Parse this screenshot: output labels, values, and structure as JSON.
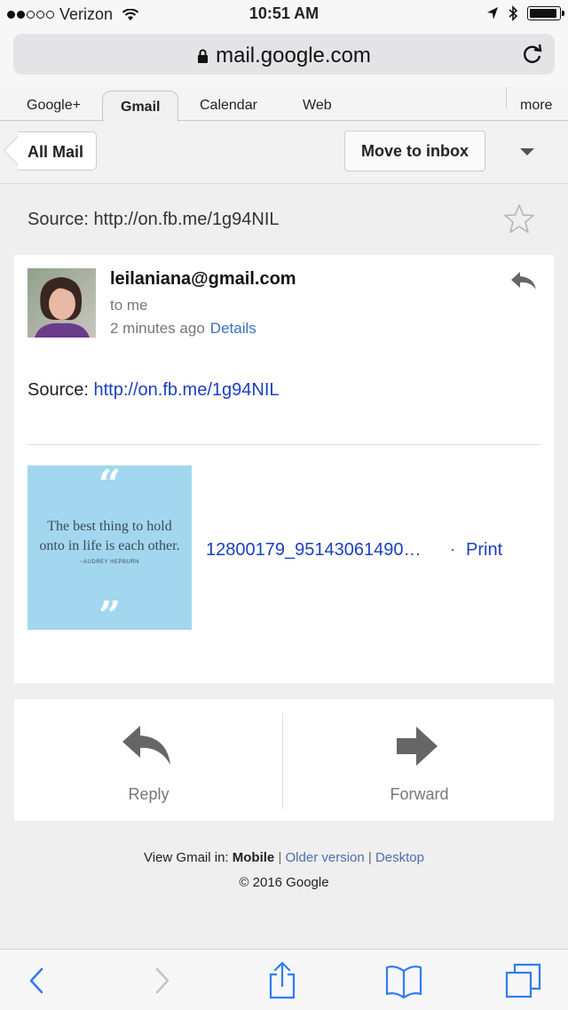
{
  "status_bar": {
    "carrier": "Verizon",
    "time": "10:51 AM",
    "signal_bars_filled": 2,
    "signal_bars_total": 5,
    "battery_level": 0.95
  },
  "browser": {
    "url": "mail.google.com"
  },
  "google_tabs": [
    "Google+",
    "Gmail",
    "Calendar",
    "Web",
    "more"
  ],
  "toolbar": {
    "back_label": "All Mail",
    "move_label": "Move to inbox"
  },
  "message": {
    "subject": "Source: http://on.fb.me/1g94NIL",
    "sender": "leilaniana@gmail.com",
    "recipient": "to me",
    "time": "2 minutes ago",
    "details_label": "Details",
    "body_prefix": "Source: ",
    "body_link": "http://on.fb.me/1g94NIL",
    "attachment": {
      "name": "12800179_95143061490…",
      "separator": "·",
      "print_label": "Print",
      "quote_line1": "The best thing to hold",
      "quote_line2": "onto in life is each other.",
      "quote_author": "~AUDREY HEPBURN"
    }
  },
  "actions": {
    "reply_label": "Reply",
    "forward_label": "Forward"
  },
  "footer": {
    "view_prefix": "View Gmail in:",
    "mobile": "Mobile",
    "older": "Older version",
    "desktop": "Desktop",
    "separator": "|",
    "copyright": "© 2016 Google"
  },
  "colors": {
    "link": "#1c3fbf",
    "ios_blue": "#2f7cf6",
    "thumb_bg": "#a2d7ef"
  }
}
